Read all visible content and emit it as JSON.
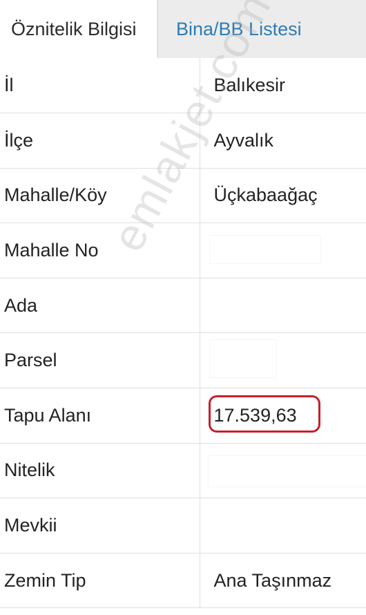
{
  "tabs": [
    {
      "label": "Öznitelik Bilgisi",
      "active": true
    },
    {
      "label": "Bina/BB Listesi",
      "active": false
    }
  ],
  "rows": [
    {
      "label": "İl",
      "value": "Balıkesir"
    },
    {
      "label": "İlçe",
      "value": "Ayvalık"
    },
    {
      "label": "Mahalle/Köy",
      "value": "Üçkabaağaç"
    },
    {
      "label": "Mahalle No",
      "value": ""
    },
    {
      "label": "Ada",
      "value": ""
    },
    {
      "label": "Parsel",
      "value": ""
    },
    {
      "label": "Tapu Alanı",
      "value": "17.539,63"
    },
    {
      "label": "Nitelik",
      "value": ""
    },
    {
      "label": "Mevkii",
      "value": ""
    },
    {
      "label": "Zemin Tip",
      "value": "Ana Taşınmaz"
    }
  ],
  "watermark": "emlakjet.com",
  "colors": {
    "tab_link": "#2e7cb3",
    "highlight": "#c4202a",
    "border": "#dedede"
  }
}
